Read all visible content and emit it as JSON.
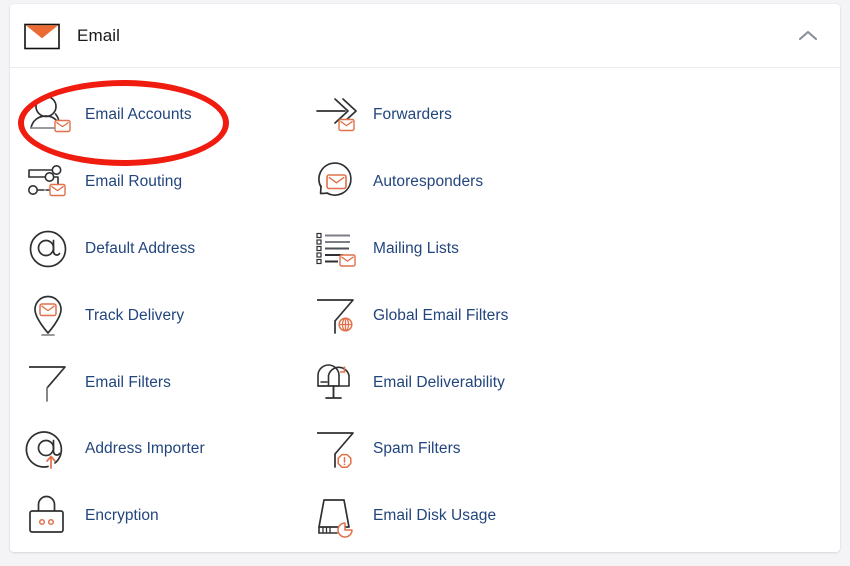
{
  "header": {
    "title": "Email",
    "icon": "envelope-icon",
    "collapse_icon": "chevron-up-icon",
    "icon_accent_color": "#ec6a34",
    "icon_outline_color": "#1a1a1a"
  },
  "theme": {
    "page_background": "#f4f4f6",
    "card_background": "#ffffff",
    "link_color": "#22457c",
    "icon_outline": "#2f3033",
    "icon_accent": "#e0714a",
    "divider": "#ececed",
    "annotation_color": "#f01c10"
  },
  "annotation": {
    "type": "ellipse-highlight",
    "target": "Email Accounts",
    "color": "#f01c10"
  },
  "tiles": [
    {
      "label": "Email Accounts",
      "icon": "user-envelope-icon",
      "column": "left",
      "row": 1
    },
    {
      "label": "Forwarders",
      "icon": "arrow-forward-envelope-icon",
      "column": "right",
      "row": 1
    },
    {
      "label": "Email Routing",
      "icon": "routing-nodes-envelope-icon",
      "column": "left",
      "row": 2
    },
    {
      "label": "Autoresponders",
      "icon": "refresh-envelope-icon",
      "column": "right",
      "row": 2
    },
    {
      "label": "Default Address",
      "icon": "at-sign-icon",
      "column": "left",
      "row": 3
    },
    {
      "label": "Mailing Lists",
      "icon": "list-envelope-icon",
      "column": "right",
      "row": 3
    },
    {
      "label": "Track Delivery",
      "icon": "map-pin-envelope-icon",
      "column": "left",
      "row": 4
    },
    {
      "label": "Global Email Filters",
      "icon": "funnel-globe-icon",
      "column": "right",
      "row": 4
    },
    {
      "label": "Email Filters",
      "icon": "funnel-icon",
      "column": "left",
      "row": 5
    },
    {
      "label": "Email Deliverability",
      "icon": "mailbox-icon",
      "column": "right",
      "row": 5
    },
    {
      "label": "Address Importer",
      "icon": "at-sign-import-icon",
      "column": "left",
      "row": 6
    },
    {
      "label": "Spam Filters",
      "icon": "funnel-alert-icon",
      "column": "right",
      "row": 6
    },
    {
      "label": "Encryption",
      "icon": "padlock-icon",
      "column": "left",
      "row": 7
    },
    {
      "label": "Email Disk Usage",
      "icon": "disk-usage-icon",
      "column": "right",
      "row": 7
    }
  ]
}
